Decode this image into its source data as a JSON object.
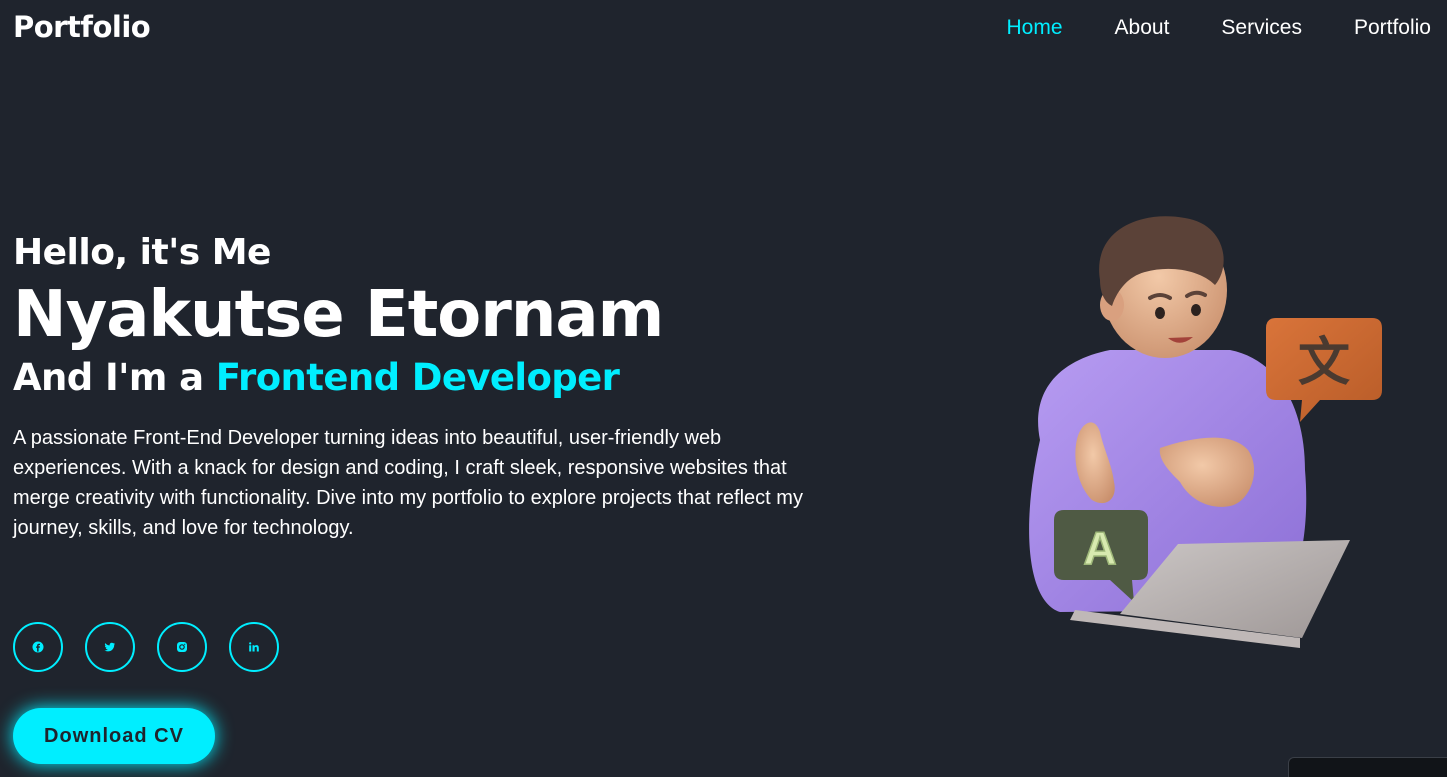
{
  "header": {
    "logo": "Portfolio",
    "nav": [
      {
        "label": "Home",
        "active": true
      },
      {
        "label": "About",
        "active": false
      },
      {
        "label": "Services",
        "active": false
      },
      {
        "label": "Portfolio",
        "active": false
      }
    ]
  },
  "hero": {
    "greeting": "Hello, it's Me",
    "name": "Nyakutse Etornam",
    "role_prefix": "And I'm a ",
    "role": "Frontend Developer",
    "description": "A passionate Front-End Developer turning ideas into beautiful, user-friendly web experiences. With a knack for design and coding, I craft sleek, responsive websites that merge creativity with functionality. Dive into my portfolio to explore projects that reflect my journey, skills, and love for technology.",
    "social_icons": [
      "facebook-icon",
      "twitter-icon",
      "instagram-icon",
      "linkedin-icon"
    ],
    "download_button": "Download CV"
  },
  "illustration": {
    "bubble_left_letter": "A",
    "bubble_right_glyph": "文"
  },
  "colors": {
    "background": "#1f242d",
    "accent": "#00eeff",
    "text": "#ffffff"
  }
}
